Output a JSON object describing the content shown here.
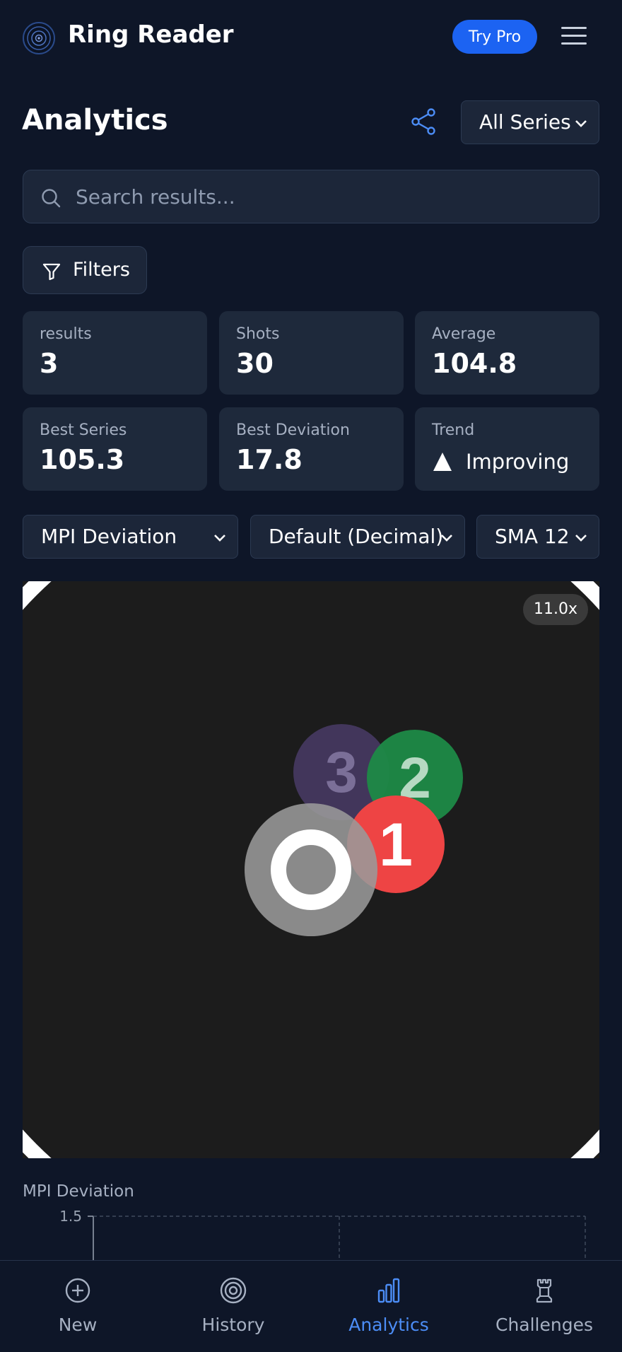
{
  "header": {
    "app_title": "Ring Reader",
    "try_pro_label": "Try Pro",
    "logo_icon": "target-logo-icon",
    "menu_icon": "hamburger-menu-icon"
  },
  "page": {
    "title": "Analytics",
    "share_icon": "share-icon",
    "series_select": "All Series"
  },
  "search": {
    "placeholder": "Search results...",
    "value": "",
    "icon": "search-icon"
  },
  "filters": {
    "label": "Filters",
    "icon": "filter-funnel-icon"
  },
  "stats": [
    {
      "label": "results",
      "value": "3"
    },
    {
      "label": "Shots",
      "value": "30"
    },
    {
      "label": "Average",
      "value": "104.8"
    },
    {
      "label": "Best Series",
      "value": "105.3"
    },
    {
      "label": "Best Deviation",
      "value": "17.8"
    },
    {
      "label": "Trend",
      "value": "Improving",
      "icon": "trend-up-triangle-icon"
    }
  ],
  "controls": {
    "metric": "MPI Deviation",
    "format": "Default (Decimal)",
    "smoothing": "SMA 12"
  },
  "target": {
    "zoom": "11.0x",
    "markers": [
      {
        "label": "3",
        "color": "#45385f"
      },
      {
        "label": "2",
        "color": "#1e8a47"
      },
      {
        "label": "1",
        "color": "#ee4444"
      }
    ],
    "center_color": "#8c8c8c"
  },
  "chart_data": {
    "type": "line",
    "ylabel": "MPI Deviation",
    "y_ticks": [
      "1.5"
    ],
    "series": []
  },
  "nav": [
    {
      "label": "New",
      "icon": "plus-circle-icon",
      "active": false
    },
    {
      "label": "History",
      "icon": "target-rings-icon",
      "active": false
    },
    {
      "label": "Analytics",
      "icon": "bar-chart-icon",
      "active": true
    },
    {
      "label": "Challenges",
      "icon": "chess-rook-icon",
      "active": false
    }
  ],
  "colors": {
    "background": "#0e1628",
    "card": "#1e293b",
    "accent": "#1c63f2",
    "active_nav": "#4c8df6"
  }
}
